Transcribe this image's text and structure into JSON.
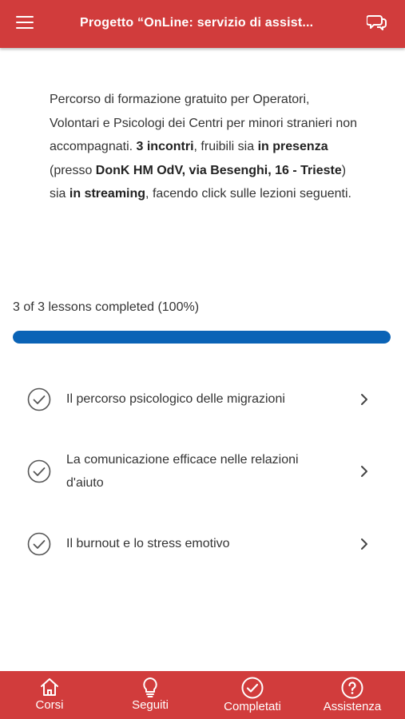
{
  "header": {
    "title": "Progetto “OnLine: servizio di assist...",
    "menu_icon": "hamburger-icon",
    "chat_icon": "chat-bubbles-icon",
    "color": "#d13c3c"
  },
  "intro": {
    "p1": "Percorso di formazione gratuito per Operatori, Volontari e Psicologi dei Centri per minori stranieri non accompagnati. ",
    "b1": "3 incontri",
    "p2": ", fruibili sia ",
    "b2": "in presenza",
    "p3": " (presso ",
    "b3": "DonK HM OdV, via Besenghi, 16 - Trieste",
    "p4": ") sia ",
    "b4": "in streaming",
    "p5": ", facendo click sulle lezioni seguenti."
  },
  "progress": {
    "text": "3 of 3 lessons completed (100%)",
    "fraction": 1.0,
    "color": "#0a63b6"
  },
  "lessons": [
    {
      "label": "Il percorso psicologico delle migrazioni",
      "status_icon": "check-circle-icon",
      "nav_icon": "chevron-right-icon"
    },
    {
      "label": "La comunicazione efficace nelle relazioni d'aiuto",
      "status_icon": "check-circle-icon",
      "nav_icon": "chevron-right-icon"
    },
    {
      "label": "Il burnout e lo stress emotivo",
      "status_icon": "check-circle-icon",
      "nav_icon": "chevron-right-icon"
    }
  ],
  "bottom_nav": [
    {
      "label": "Corsi",
      "icon": "home-icon"
    },
    {
      "label": "Seguiti",
      "icon": "lightbulb-icon"
    },
    {
      "label": "Completati",
      "icon": "check-circle-icon"
    },
    {
      "label": "Assistenza",
      "icon": "question-circle-icon"
    }
  ]
}
